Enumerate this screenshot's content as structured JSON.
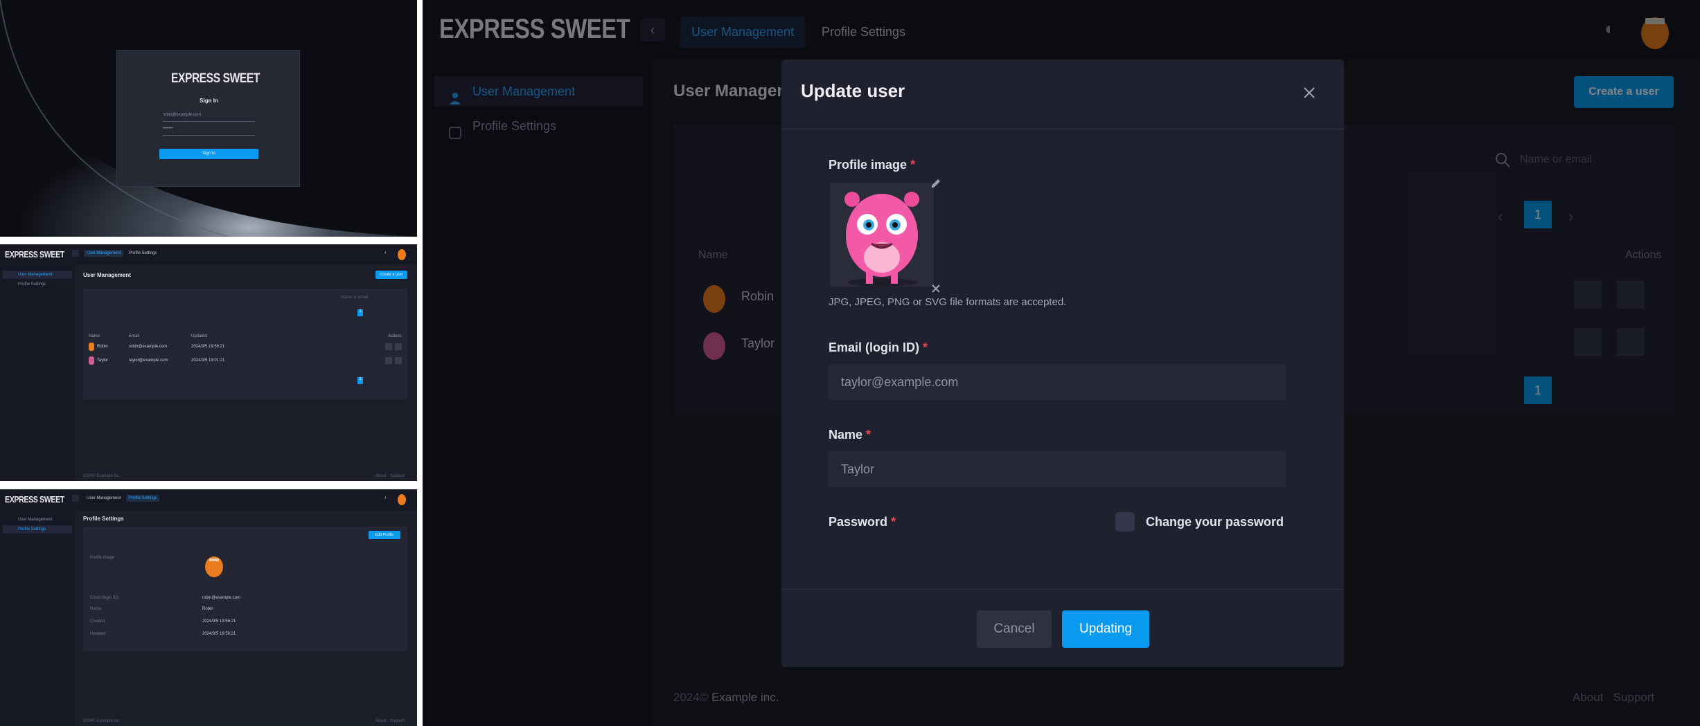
{
  "brand": "EXPRESS SWEET",
  "colors": {
    "accent": "#0a9bf0",
    "accent_text": "#2aa6ff",
    "danger": "#e5484d",
    "modal_bg": "#1f212e"
  },
  "signin": {
    "title": "Sign In",
    "email_value": "robin@example.com",
    "password_value": "•••••••",
    "button": "Sign In"
  },
  "nav": {
    "tabs": [
      "User Management",
      "Profile Settings"
    ],
    "sidebar": [
      "User Management",
      "Profile Settings"
    ]
  },
  "users_page": {
    "title": "User Management",
    "create_button": "Create a user",
    "search_placeholder": "Name or email",
    "pagination": {
      "current": "1"
    },
    "columns": [
      "Name",
      "Email",
      "Updated",
      "Actions"
    ],
    "rows": [
      {
        "name": "Robin",
        "email": "robin@example.com",
        "updated": "2024/3/5 19:56:21"
      },
      {
        "name": "Taylor",
        "email": "taylor@example.com",
        "updated": "2024/3/5 19:01:21"
      }
    ]
  },
  "profile_page": {
    "title": "Profile Settings",
    "edit_button": "Edit Profile",
    "fields": [
      {
        "label": "Profile image",
        "value": ""
      },
      {
        "label": "Email (login ID)",
        "value": "robin@example.com"
      },
      {
        "label": "Name",
        "value": "Robin"
      },
      {
        "label": "Created",
        "value": "2024/3/5 19:56:21"
      },
      {
        "label": "Updated",
        "value": "2024/3/5 19:56:21"
      }
    ]
  },
  "footer": {
    "copyright": "2024©",
    "company": "Example inc.",
    "links": [
      "About",
      "Support"
    ]
  },
  "modal": {
    "title": "Update user",
    "profile_image_label": "Profile image",
    "formats_hint": "JPG, JPEG, PNG or SVG file formats are accepted.",
    "email_label": "Email (login ID)",
    "email_value": "taylor@example.com",
    "name_label": "Name",
    "name_value": "Taylor",
    "password_label": "Password",
    "change_password_label": "Change your password",
    "cancel": "Cancel",
    "submit": "Updating"
  },
  "icons": [
    "close-icon",
    "edit-pencil-icon",
    "remove-image-icon",
    "search-icon",
    "sort-up-icon",
    "toggle-icon",
    "trash-icon",
    "moon-icon",
    "chevron-left-icon",
    "chevron-right-icon",
    "user-icon",
    "settings-icon"
  ]
}
